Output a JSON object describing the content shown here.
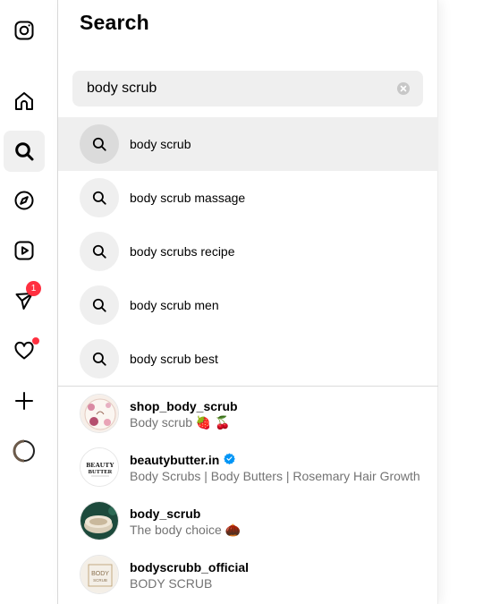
{
  "sidebar": {
    "items": [
      {
        "name": "instagram-logo",
        "icon": "instagram-icon"
      },
      {
        "name": "home",
        "icon": "home-icon"
      },
      {
        "name": "search",
        "icon": "search-icon",
        "active": true
      },
      {
        "name": "explore",
        "icon": "compass-icon"
      },
      {
        "name": "reels",
        "icon": "reels-icon"
      },
      {
        "name": "messages",
        "icon": "messenger-icon",
        "badge": "1"
      },
      {
        "name": "notifications",
        "icon": "heart-icon",
        "dot": true
      },
      {
        "name": "create",
        "icon": "plus-icon"
      },
      {
        "name": "profile",
        "icon": "avatar"
      }
    ],
    "messages_badge": "1"
  },
  "search": {
    "title": "Search",
    "query": "body scrub"
  },
  "suggestions": [
    {
      "label": "body scrub"
    },
    {
      "label": "body scrub massage"
    },
    {
      "label": "body scrubs recipe"
    },
    {
      "label": "body scrub men"
    },
    {
      "label": "body scrub best"
    }
  ],
  "accounts": [
    {
      "username": "shop_body_scrub",
      "subtitle": "Body scrub 🍓 🍒",
      "verified": false
    },
    {
      "username": "beautybutter.in",
      "subtitle": "Body Scrubs | Body Butters | Rosemary Hair Growth",
      "verified": true
    },
    {
      "username": "body_scrub",
      "subtitle": "The body choice 🌰",
      "verified": false
    },
    {
      "username": "bodyscrubb_official",
      "subtitle": "BODY SCRUB",
      "verified": false
    }
  ],
  "avatar_logos": {
    "beautybutter": "BEAUTY BUTTER",
    "bodyscrubb": "BODY SCRUB"
  },
  "colors": {
    "badge": "#ff3040",
    "verified": "#0095f6",
    "secondary_text": "#737373",
    "highlight_bg": "#efefef"
  }
}
